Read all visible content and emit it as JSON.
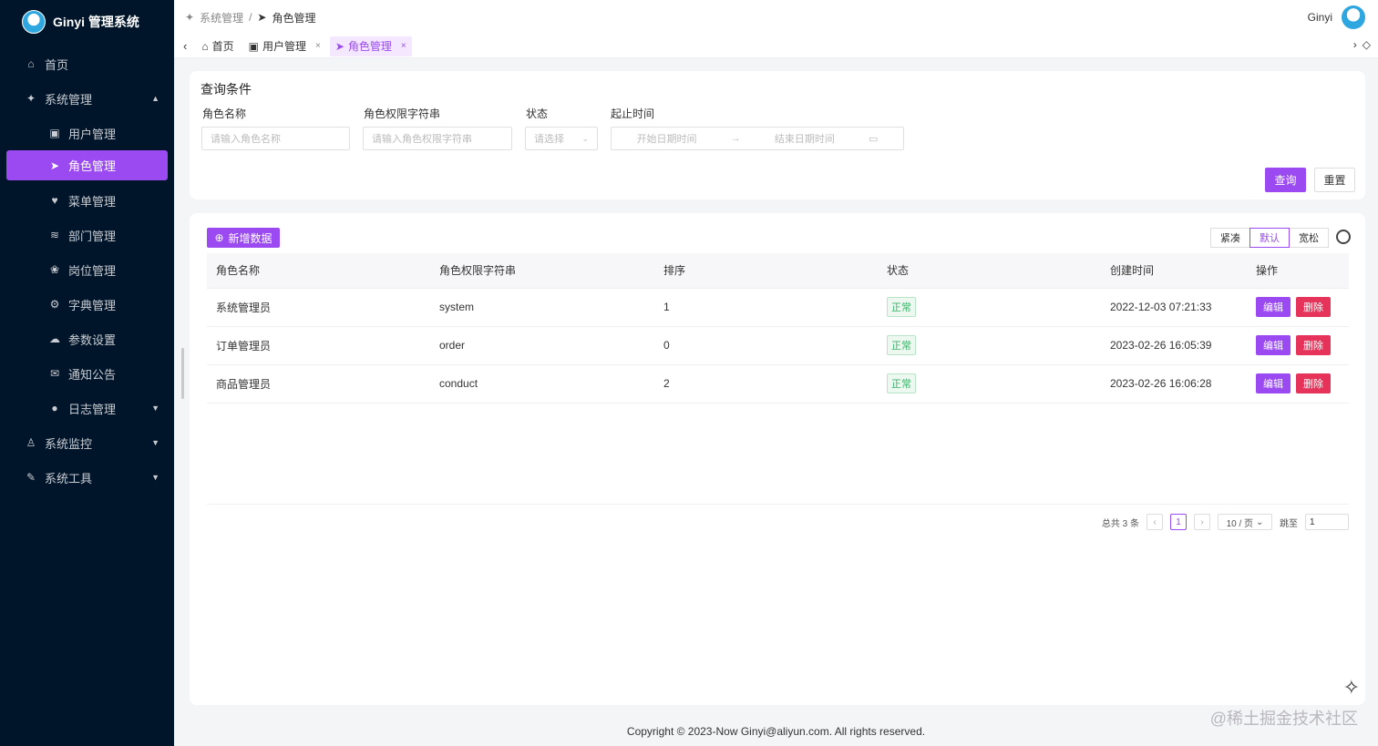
{
  "app": {
    "title": "Ginyi 管理系统"
  },
  "sidebar": {
    "items": [
      {
        "label": "首页",
        "icon": "home-icon"
      },
      {
        "label": "系统管理",
        "icon": "person-icon"
      },
      {
        "label": "用户管理",
        "icon": "user-manage-icon"
      },
      {
        "label": "角色管理",
        "icon": "role-icon"
      },
      {
        "label": "菜单管理",
        "icon": "heart-icon"
      },
      {
        "label": "部门管理",
        "icon": "layers-icon"
      },
      {
        "label": "岗位管理",
        "icon": "paw-icon"
      },
      {
        "label": "字典管理",
        "icon": "dict-icon"
      },
      {
        "label": "参数设置",
        "icon": "params-icon"
      },
      {
        "label": "通知公告",
        "icon": "notice-icon"
      },
      {
        "label": "日志管理",
        "icon": "mic-icon"
      },
      {
        "label": "系统监控",
        "icon": "monitor-icon"
      },
      {
        "label": "系统工具",
        "icon": "wrench-icon"
      }
    ]
  },
  "header": {
    "breadcrumb": [
      "系统管理",
      "角色管理"
    ],
    "separator": "/",
    "username": "Ginyi"
  },
  "tabs": [
    {
      "label": "首页"
    },
    {
      "label": "用户管理"
    },
    {
      "label": "角色管理"
    }
  ],
  "query": {
    "title": "查询条件",
    "fields": [
      {
        "label": "角色名称",
        "placeholder": "请输入角色名称"
      },
      {
        "label": "角色权限字符串",
        "placeholder": "请输入角色权限字符串"
      },
      {
        "label": "状态",
        "placeholder": "请选择"
      },
      {
        "label": "起止时间",
        "start_placeholder": "开始日期时间",
        "end_placeholder": "结束日期时间"
      }
    ],
    "search_label": "查询",
    "reset_label": "重置"
  },
  "table": {
    "add_label": "新增数据",
    "density": [
      "紧凑",
      "默认",
      "宽松"
    ],
    "columns": [
      "角色名称",
      "角色权限字符串",
      "排序",
      "状态",
      "创建时间",
      "操作"
    ],
    "rows": [
      {
        "name": "系统管理员",
        "key": "system",
        "sort": "1",
        "status": "正常",
        "created": "2022-12-03 07:21:33"
      },
      {
        "name": "订单管理员",
        "key": "order",
        "sort": "0",
        "status": "正常",
        "created": "2023-02-26 16:05:39"
      },
      {
        "name": "商品管理员",
        "key": "conduct",
        "sort": "2",
        "status": "正常",
        "created": "2023-02-26 16:06:28"
      }
    ],
    "edit_label": "编辑",
    "delete_label": "删除"
  },
  "pagination": {
    "total_text": "总共 3 条",
    "current_page": "1",
    "page_size": "10 / 页",
    "jump_label": "跳至",
    "jump_value": "1"
  },
  "footer": {
    "copyright": "Copyright © 2023-Now Ginyi@aliyun.com. All rights reserved."
  },
  "watermark": "@稀土掘金技术社区",
  "colors": {
    "accent": "#9a4af0",
    "sidebar_bg": "#001529",
    "danger": "#e5335a",
    "success": "#3bb46a"
  }
}
